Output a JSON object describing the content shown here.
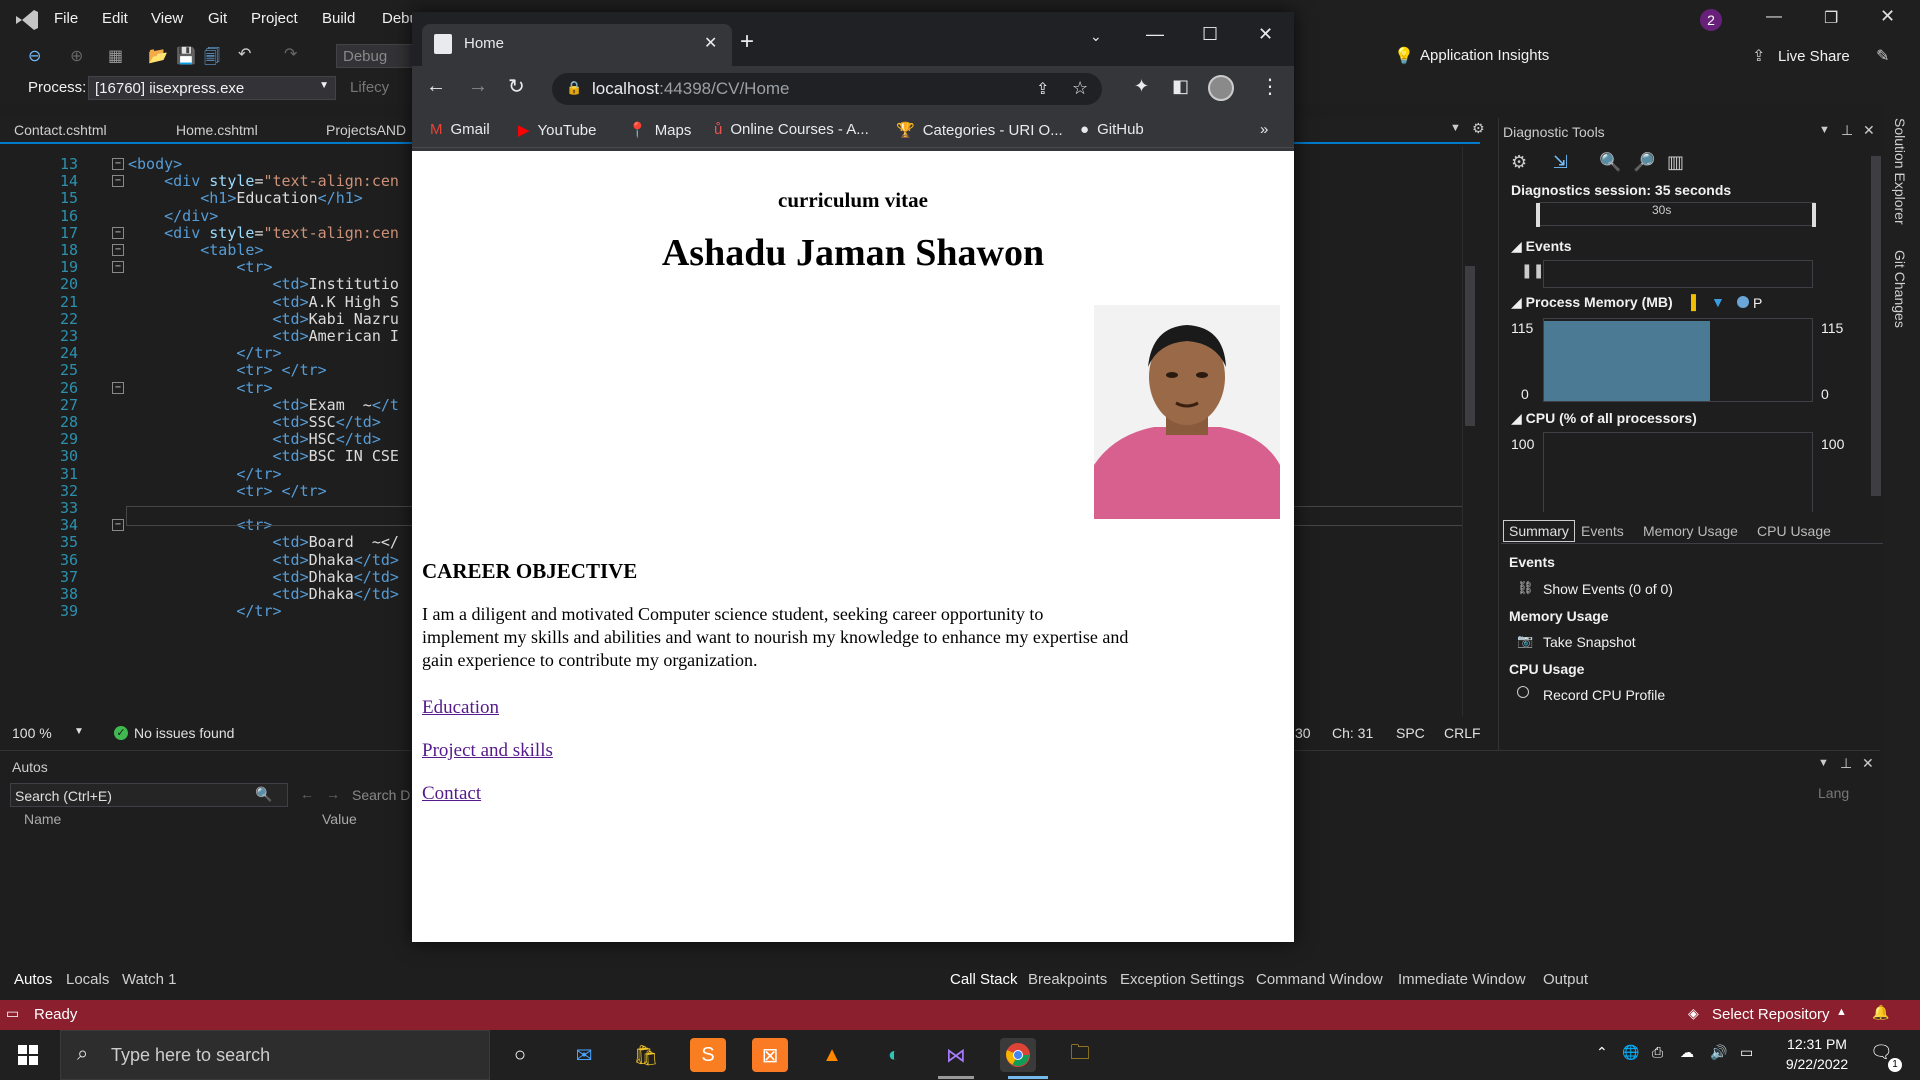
{
  "vs": {
    "menu": [
      "File",
      "Edit",
      "View",
      "Git",
      "Project",
      "Build",
      "Debu"
    ],
    "notification_count": "2",
    "toolbar": {
      "config": "Debug",
      "app_insights": "Application Insights",
      "live_share": "Live Share",
      "process_label": "Process:",
      "process_value": "[16760] iisexpress.exe",
      "lifecycle": "Lifecy"
    },
    "doc_tabs": [
      "Contact.cshtml",
      "Home.cshtml",
      "ProjectsAND"
    ],
    "code_lines": [
      {
        "n": "13",
        "t": "<body>"
      },
      {
        "n": "14",
        "t": "    <div style=\"text-align:cen"
      },
      {
        "n": "15",
        "t": "        <h1>Education</h1>"
      },
      {
        "n": "16",
        "t": "    </div>"
      },
      {
        "n": "17",
        "t": "    <div style=\"text-align:cen"
      },
      {
        "n": "18",
        "t": "        <table>"
      },
      {
        "n": "19",
        "t": "            <tr>"
      },
      {
        "n": "20",
        "t": "                <td>Institutio"
      },
      {
        "n": "21",
        "t": "                <td>A.K High S"
      },
      {
        "n": "22",
        "t": "                <td>Kabi Nazru"
      },
      {
        "n": "23",
        "t": "                <td>American I"
      },
      {
        "n": "24",
        "t": "            </tr>"
      },
      {
        "n": "25",
        "t": "            <tr> </tr>"
      },
      {
        "n": "26",
        "t": "            <tr>"
      },
      {
        "n": "27",
        "t": "                <td>Exam  ~</t"
      },
      {
        "n": "28",
        "t": "                <td>SSC</td>"
      },
      {
        "n": "29",
        "t": "                <td>HSC</td>"
      },
      {
        "n": "30",
        "t": "                <td>BSC IN CSE"
      },
      {
        "n": "31",
        "t": "            </tr>"
      },
      {
        "n": "32",
        "t": "            <tr> </tr>"
      },
      {
        "n": "33",
        "t": ""
      },
      {
        "n": "34",
        "t": "            <tr>"
      },
      {
        "n": "35",
        "t": "                <td>Board  ~</"
      },
      {
        "n": "36",
        "t": "                <td>Dhaka</td>"
      },
      {
        "n": "37",
        "t": "                <td>Dhaka</td>"
      },
      {
        "n": "38",
        "t": "                <td>Dhaka</td>"
      },
      {
        "n": "39",
        "t": "            </tr>"
      }
    ],
    "editor_status": {
      "zoom": "100 %",
      "issues": "No issues found",
      "line_col": "30",
      "ch": "Ch: 31",
      "spc": "SPC",
      "crlf": "CRLF"
    },
    "autos": {
      "title": "Autos",
      "search_placeholder": "Search (Ctrl+E)",
      "search_depth": "Search D",
      "col_name": "Name",
      "col_value": "Value",
      "lang": "Lang"
    },
    "bottom_tabs_left": [
      "Autos",
      "Locals",
      "Watch 1"
    ],
    "bottom_tabs_right": [
      "Call Stack",
      "Breakpoints",
      "Exception Settings",
      "Command Window",
      "Immediate Window",
      "Output"
    ],
    "diag": {
      "title": "Diagnostic Tools",
      "session": "Diagnostics session: 35 seconds",
      "tick_30s": "30s",
      "events_label": "Events",
      "memory_label": "Process Memory (MB)",
      "memory_max": "115",
      "memory_min": "0",
      "memory_legend": "P",
      "memory_fill_fraction": 0.62,
      "cpu_label": "CPU (% of all processors)",
      "cpu_max": "100",
      "tabs": [
        "Summary",
        "Events",
        "Memory Usage",
        "CPU Usage"
      ],
      "section_events": "Events",
      "show_events": "Show Events (0 of 0)",
      "section_memory": "Memory Usage",
      "take_snapshot": "Take Snapshot",
      "section_cpu": "CPU Usage",
      "record_cpu": "Record CPU Profile"
    },
    "side_strip": [
      "Solution Explorer",
      "Git Changes"
    ],
    "status": {
      "ready": "Ready",
      "select_repo": "Select Repository",
      "notif": "1"
    }
  },
  "chrome": {
    "tab_title": "Home",
    "url_host": "localhost",
    "url_path": ":44398/CV/Home",
    "bookmarks": [
      {
        "label": "Gmail",
        "icon": "gmail-icon"
      },
      {
        "label": "YouTube",
        "icon": "youtube-icon"
      },
      {
        "label": "Maps",
        "icon": "maps-icon"
      },
      {
        "label": "Online Courses - A...",
        "icon": "udemy-icon"
      },
      {
        "label": "Categories - URI O...",
        "icon": "trophy-icon"
      },
      {
        "label": "GitHub",
        "icon": "github-icon"
      }
    ],
    "more_bookmarks": "»"
  },
  "page": {
    "subtitle": "curriculum vitae",
    "name": "Ashadu Jaman Shawon",
    "career_heading": "CAREER OBJECTIVE",
    "career_text_1": "I am a diligent and motivated Computer science student, seeking career opportunity to",
    "career_text_2": "implement my skills and abilities and want to nourish my knowledge to enhance my expertise and",
    "career_text_3": "gain experience to contribute my organization.",
    "links": [
      "Education",
      "Project and skills",
      "Contact"
    ]
  },
  "taskbar": {
    "search_placeholder": "Type here to search",
    "time": "12:31 PM",
    "date": "9/22/2022",
    "notif": "1"
  },
  "colors": {
    "vs_status": "#8b1f2e",
    "accent": "#007acc",
    "memory_fill": "#4a7a94"
  }
}
